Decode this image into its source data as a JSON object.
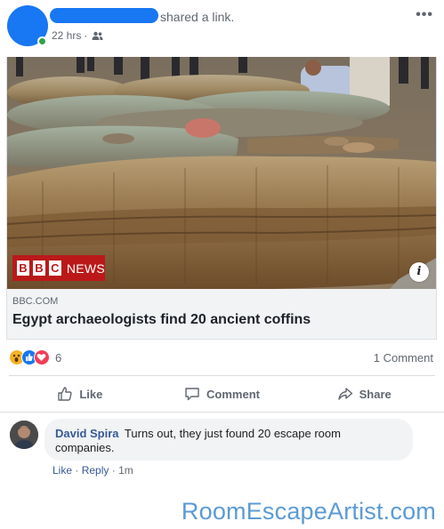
{
  "post": {
    "shared_text": "shared a link.",
    "time": "22 hrs",
    "separator": "·",
    "more_label": "•••"
  },
  "link": {
    "domain": "BBC.COM",
    "title": "Egypt archaeologists find 20 ancient coffins",
    "badge_letters": [
      "B",
      "B",
      "C"
    ],
    "badge_word": "NEWS",
    "info_label": "i"
  },
  "stats": {
    "reaction_count": "6",
    "comment_count": "1 Comment"
  },
  "actions": {
    "like": "Like",
    "comment": "Comment",
    "share": "Share"
  },
  "comment": {
    "author": "David Spira",
    "text": "Turns out, they just found 20 escape room companies.",
    "like_label": "Like",
    "reply_label": "Reply",
    "meta_sep": "·",
    "time": "1m"
  },
  "watermark": "RoomEscapeArtist.com",
  "colors": {
    "brand_blue": "#1877f2",
    "link_blue": "#385898",
    "bbc_red": "#bb1919",
    "watermark_blue": "#5b9bd5"
  }
}
